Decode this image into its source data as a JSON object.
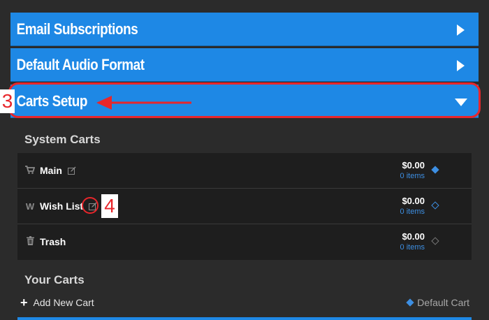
{
  "accordion": {
    "email_subscriptions": "Email Subscriptions",
    "default_audio_format": "Default Audio Format",
    "carts_setup": "Carts Setup"
  },
  "annotations": {
    "step3": "3",
    "step4": "4"
  },
  "system_carts": {
    "heading": "System Carts",
    "items": [
      {
        "icon": "cart-icon",
        "name": "Main",
        "price": "$0.00",
        "count": "0 items",
        "is_default": true
      },
      {
        "icon": "w-letter-icon",
        "icon_text": "W",
        "name": "Wish List",
        "price": "$0.00",
        "count": "0 items",
        "is_default": false
      },
      {
        "icon": "trash-icon",
        "name": "Trash",
        "price": "$0.00",
        "count": "0 items",
        "is_default": false
      }
    ]
  },
  "your_carts": {
    "heading": "Your Carts",
    "add_label": "Add New Cart",
    "default_legend": "Default Cart"
  },
  "colors": {
    "accent_blue": "#1e88e5",
    "annotation_red": "#e8262b",
    "link_blue": "#3d8fe3",
    "background": "#2b2b2b"
  }
}
